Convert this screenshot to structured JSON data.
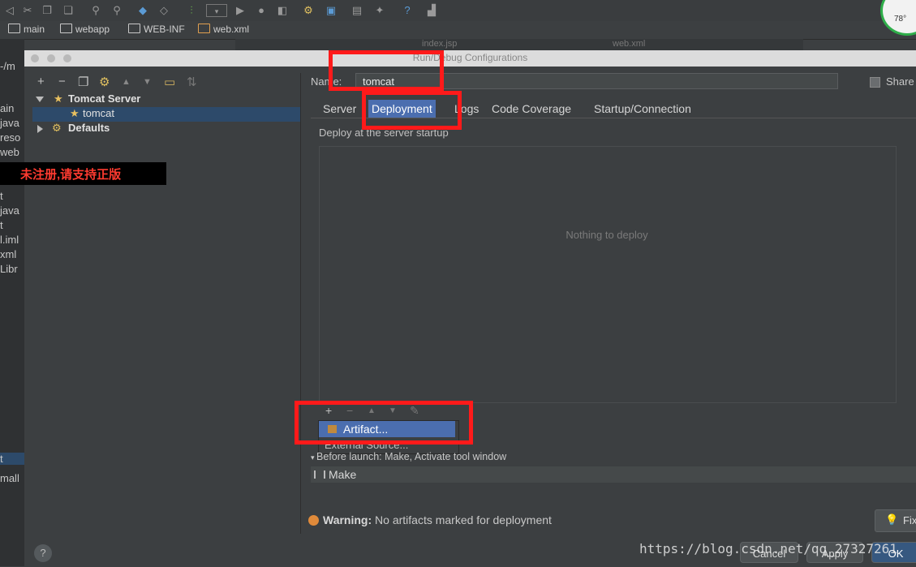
{
  "breadcrumbs": [
    "main",
    "webapp",
    "WEB-INF",
    "web.xml"
  ],
  "editor_tabs": [
    "index.jsp",
    "web.xml"
  ],
  "left_strip_labels": [
    "-/m",
    "ain",
    "java",
    "reso",
    "web",
    "t",
    "java",
    "t",
    "l.iml",
    "xml",
    "Libr",
    "t",
    "mall"
  ],
  "dialog": {
    "title": "Run/Debug Configurations",
    "tree": {
      "group": "Tomcat Server",
      "child": "tomcat",
      "defaults": "Defaults"
    },
    "name_label": "Name:",
    "name_value": "tomcat",
    "share_label": "Share",
    "tabs": [
      "Server",
      "Deployment",
      "Logs",
      "Code Coverage",
      "Startup/Connection"
    ],
    "active_tab": "Deployment",
    "deploy_label": "Deploy at the server startup",
    "empty_text": "Nothing to deploy",
    "popup": {
      "item1": "Artifact...",
      "item2": "External Source..."
    },
    "before_launch": "Before launch: Make, Activate tool window",
    "make_item": "Make",
    "warning_label": "Warning:",
    "warning_text": "No artifacts marked for deployment",
    "fix_label": "Fix",
    "buttons": {
      "cancel": "Cancel",
      "apply": "Apply",
      "ok": "OK"
    }
  },
  "watermark_text": "未注册,请支持正版",
  "url_watermark": "https://blog.csdn.net/qq_27327261",
  "gauge_text": "78°"
}
